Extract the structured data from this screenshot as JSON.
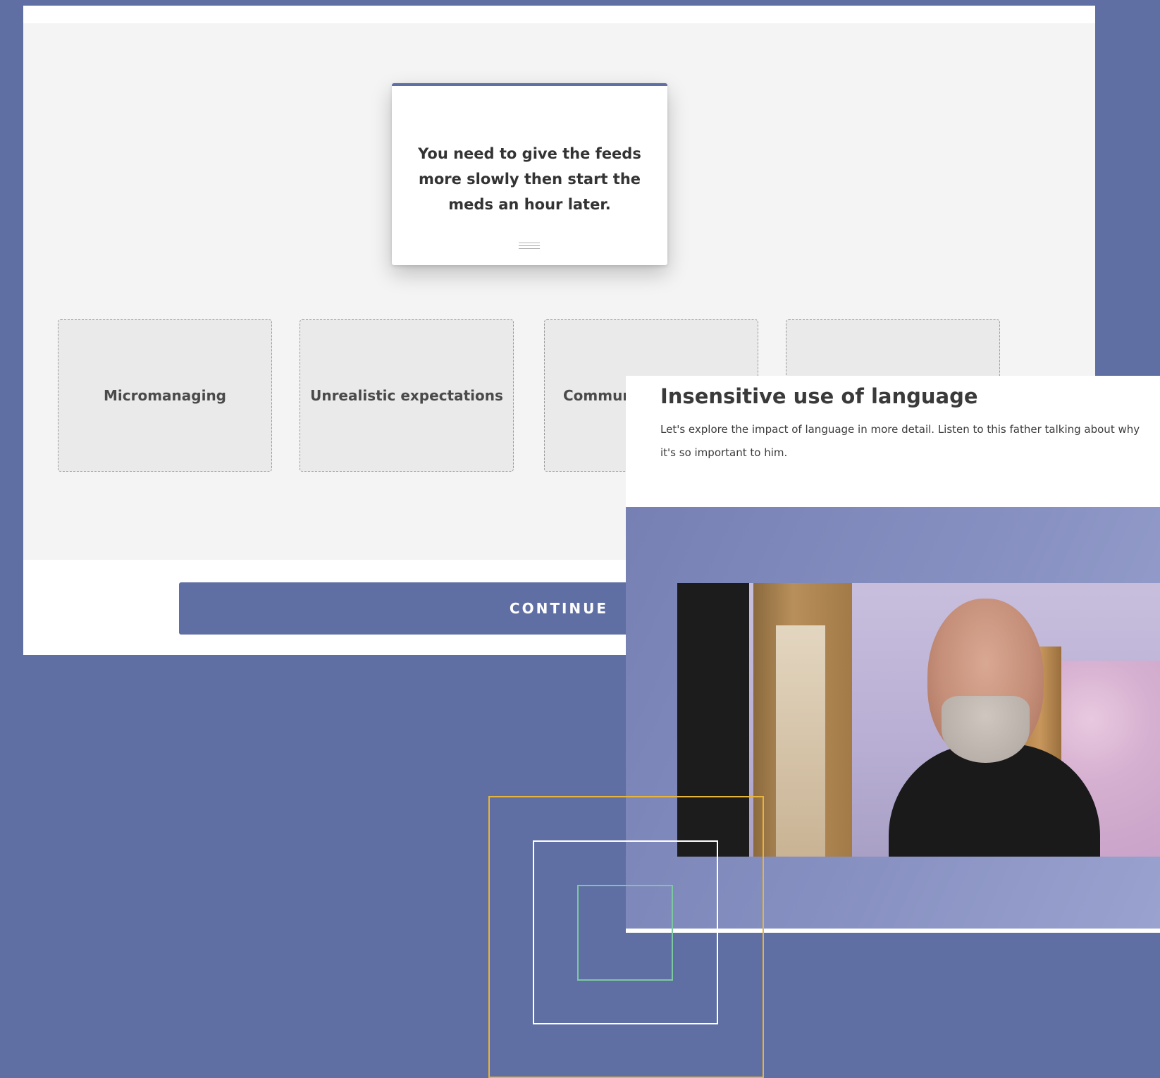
{
  "activity": {
    "drag_card_text": "You need to give the feeds more slowly then start the meds an hour later.",
    "drop_zones": [
      "Micromanaging",
      "Unrealistic expectations",
      "Communi",
      ""
    ],
    "continue_label": "CONTINUE"
  },
  "lesson": {
    "title": "Insensitive use of language",
    "description": "Let's explore the impact of language in more detail. Listen to this father talking about why it's so important to him."
  },
  "icons": {
    "drag_handle": "drag-handle-icon"
  },
  "colors": {
    "background": "#5f6fa3",
    "accent": "#5f6fa3",
    "deco_gold": "#e7b43c",
    "deco_green": "#7cc9a0"
  }
}
